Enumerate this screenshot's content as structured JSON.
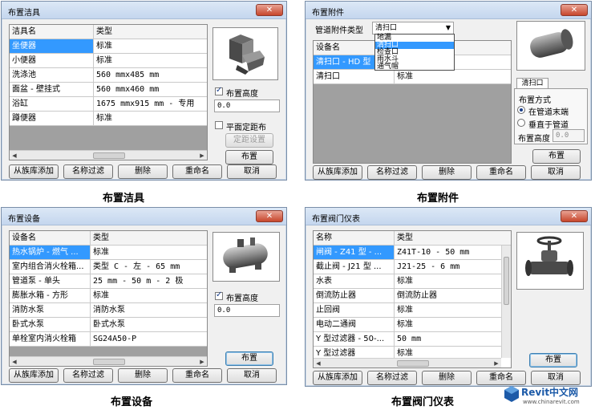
{
  "fixtures": {
    "title": "布置洁具",
    "close": "✕",
    "headers": [
      "洁具名",
      "类型"
    ],
    "rows": [
      [
        "坐便器",
        "标准"
      ],
      [
        "小便器",
        "标准"
      ],
      [
        "洗涤池",
        "560 mmx485 mm"
      ],
      [
        "面盆 - 壁挂式",
        "560 mmx460 mm"
      ],
      [
        "浴缸",
        "1675 mmx915 mm - 专用"
      ],
      [
        "蹲便器",
        "标准"
      ]
    ],
    "height_label": "布置高度",
    "height_value": "0.0",
    "plane_label": "平面定距布",
    "spacing_btn": "定距设置",
    "place_btn": "布置",
    "buttons": [
      "从族库添加",
      "名称过滤",
      "删除",
      "重命名",
      "取消"
    ],
    "caption": "布置洁具"
  },
  "fittings": {
    "title": "布置附件",
    "close": "✕",
    "type_label": "管道附件类型",
    "type_value": "清扫口",
    "options": [
      "地漏",
      "清扫口",
      "检查口",
      "雨水斗",
      "通气帽"
    ],
    "headers": [
      "设备名",
      ""
    ],
    "rows": [
      [
        "清扫口 - HD 型",
        ""
      ],
      [
        "清扫口",
        "标准"
      ]
    ],
    "tab": "清扫口",
    "method_label": "布置方式",
    "radio1": "在管道末端",
    "radio2": "垂直于管道",
    "height_label": "布置高度",
    "height_value": "0.0",
    "place_btn": "布置",
    "buttons": [
      "从族库添加",
      "名称过滤",
      "删除",
      "重命名",
      "取消"
    ],
    "caption": "布置附件"
  },
  "equipment": {
    "title": "布置设备",
    "close": "✕",
    "headers": [
      "设备名",
      "类型"
    ],
    "rows": [
      [
        "热水锅炉 - 燃气 ...",
        "标准"
      ],
      [
        "室内组合消火栓箱...",
        "类型 C - 左 - 65 mm"
      ],
      [
        "管道泵 - 单头",
        "25 mm - 50 m - 2 极"
      ],
      [
        "膨胀水箱 - 方形",
        "标准"
      ],
      [
        "消防水泵",
        "消防水泵"
      ],
      [
        "卧式水泵",
        "卧式水泵"
      ],
      [
        "单栓室内消火栓箱",
        "SG24A50-P"
      ]
    ],
    "height_label": "布置高度",
    "height_value": "0.0",
    "place_btn": "布置",
    "buttons": [
      "从族库添加",
      "名称过滤",
      "删除",
      "重命名",
      "取消"
    ],
    "caption": "布置设备"
  },
  "valves": {
    "title": "布置阀门仪表",
    "close": "✕",
    "headers": [
      "名称",
      "类型"
    ],
    "rows": [
      [
        "闸阀 - Z41 型 - ...",
        "Z41T-10 - 50 mm"
      ],
      [
        "截止阀 - J21 型 ...",
        "J21-25 - 6 mm"
      ],
      [
        "水表",
        "标准"
      ],
      [
        "倒流防止器",
        "倒流防止器"
      ],
      [
        "止回阀",
        "标准"
      ],
      [
        "电动二通阀",
        "标准"
      ],
      [
        "Y 型过滤器 - 50-...",
        "50 mm"
      ],
      [
        "Y 型过滤器",
        "标准"
      ]
    ],
    "place_btn": "布置",
    "buttons": [
      "从族库添加",
      "名称过滤",
      "删除",
      "重命名",
      "取消"
    ],
    "caption": "布置阀门仪表"
  },
  "watermark": {
    "brand": "Revit中文网",
    "url": "www.chinarevit.com"
  }
}
